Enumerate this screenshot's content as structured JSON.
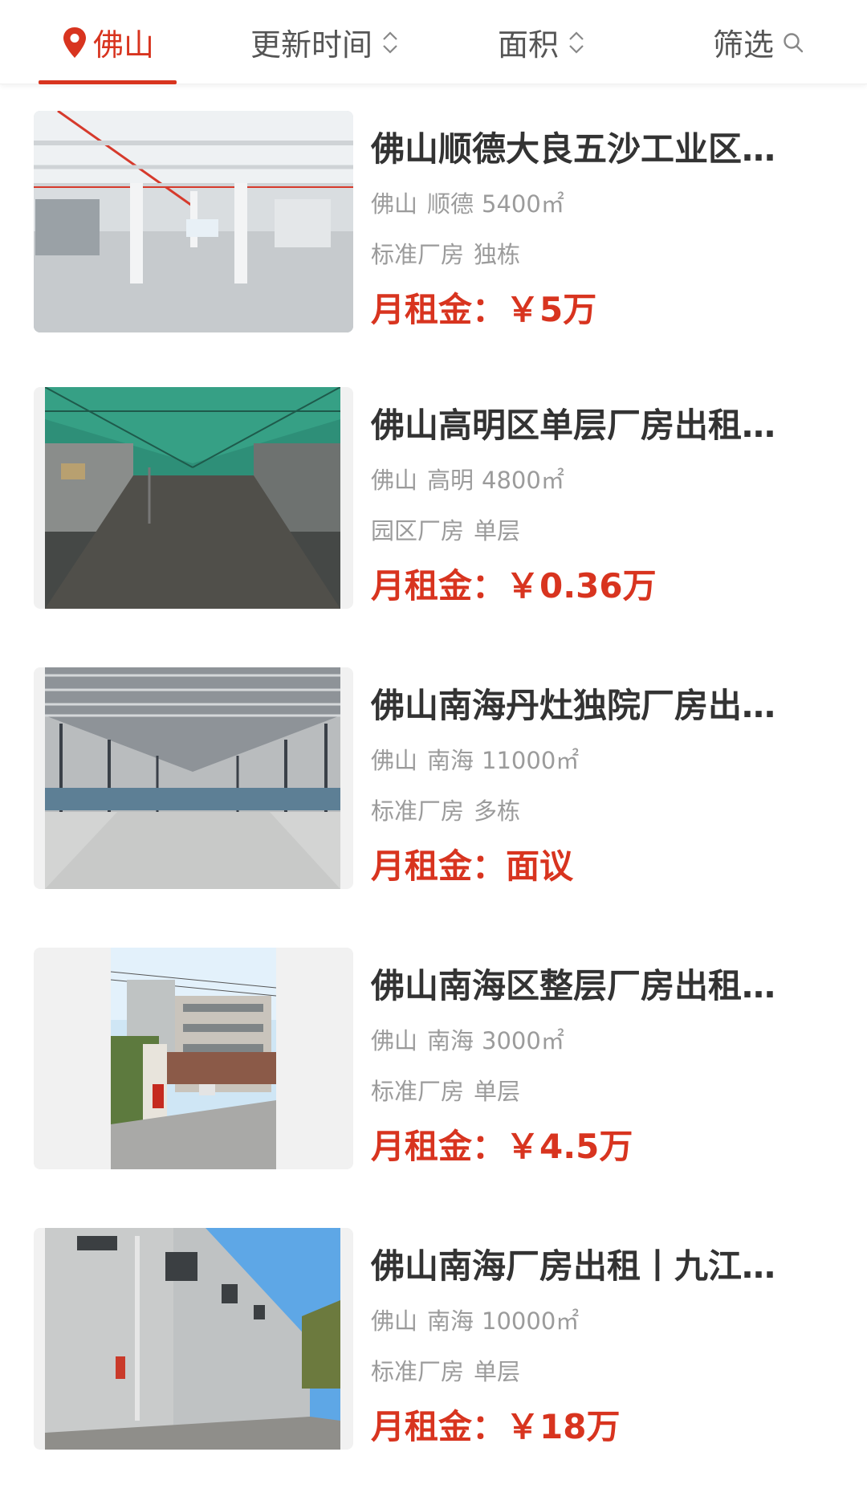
{
  "header": {
    "city": "佛山",
    "sort_update_label": "更新时间",
    "sort_area_label": "面积",
    "filter_label": "筛选",
    "accent_color": "#d8341f"
  },
  "listings": [
    {
      "title": "佛山顺德大良五沙工业区…",
      "city": "佛山",
      "district": "顺德",
      "area": "5400㎡",
      "type": "标准厂房",
      "building": "独栋",
      "price": "月租金：￥5万",
      "image": "factory-interior-photo"
    },
    {
      "title": "佛山高明区单层厂房出租…",
      "city": "佛山",
      "district": "高明",
      "area": "4800㎡",
      "type": "园区厂房",
      "building": "单层",
      "price": "月租金：￥0.36万",
      "image": "steel-shed-interior-photo"
    },
    {
      "title": "佛山南海丹灶独院厂房出…",
      "city": "佛山",
      "district": "南海",
      "area": "11000㎡",
      "type": "标准厂房",
      "building": "多栋",
      "price": "月租金：面议",
      "image": "steel-truss-warehouse-photo"
    },
    {
      "title": "佛山南海区整层厂房出租…",
      "city": "佛山",
      "district": "南海",
      "area": "3000㎡",
      "type": "标准厂房",
      "building": "单层",
      "price": "月租金：￥4.5万",
      "image": "multi-storey-building-photo"
    },
    {
      "title": "佛山南海厂房出租丨九江…",
      "city": "佛山",
      "district": "南海",
      "area": "10000㎡",
      "type": "标准厂房",
      "building": "单层",
      "price": "月租金：￥18万",
      "image": "factory-exterior-wall-photo"
    }
  ]
}
